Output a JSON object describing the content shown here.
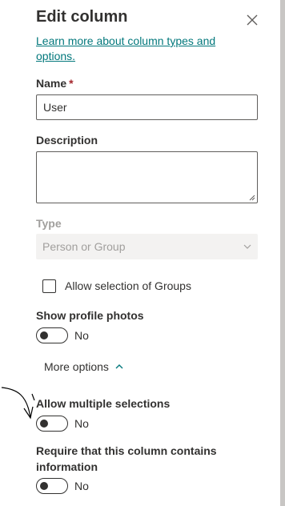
{
  "panel": {
    "title": "Edit column",
    "learn_link": "Learn more about column types and options."
  },
  "name_field": {
    "label": "Name",
    "required_mark": "*",
    "value": "User"
  },
  "description_field": {
    "label": "Description",
    "value": ""
  },
  "type_field": {
    "label": "Type",
    "value": "Person or Group"
  },
  "allow_groups": {
    "label": "Allow selection of Groups",
    "checked": false
  },
  "profile_photos": {
    "label": "Show profile photos",
    "state": "No"
  },
  "more_options": {
    "label": "More options"
  },
  "multiple_selections": {
    "label": "Allow multiple selections",
    "state": "No"
  },
  "require_info": {
    "label": "Require that this column contains information",
    "state": "No"
  },
  "colors": {
    "link": "#03787c",
    "required": "#a4262c",
    "text": "#323130",
    "disabled": "#a19f9d"
  }
}
